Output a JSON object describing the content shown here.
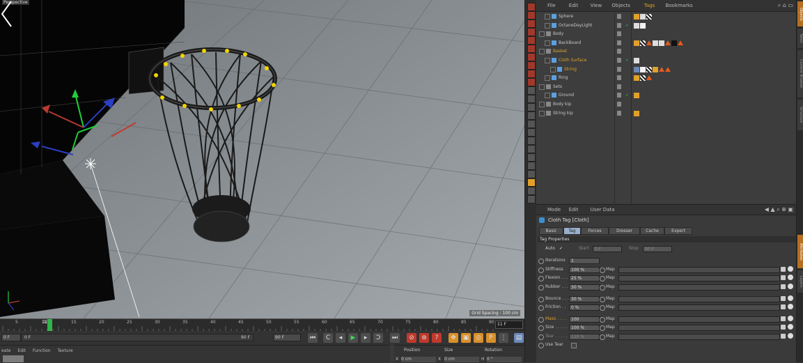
{
  "viewport": {
    "label": "Perspective",
    "grid_spacing": "Grid Spacing : 100 cm"
  },
  "timeline": {
    "ticks": [
      "5",
      "10",
      "15",
      "20",
      "25",
      "30",
      "35",
      "40",
      "45",
      "50",
      "55",
      "60",
      "65",
      "70",
      "75",
      "80",
      "85",
      "90"
    ],
    "current_frame_marker": "11",
    "frame_field": "11 F"
  },
  "transport": {
    "start_field": "0 F",
    "preview_start": "0 F",
    "preview_end": "90 F",
    "end_field": "90 F"
  },
  "material_manager": {
    "menu": [
      "eate",
      "Edit",
      "Function",
      "Texture"
    ]
  },
  "coordinates": {
    "headers": [
      "Position",
      "Size",
      "Rotation"
    ],
    "x_label": "X",
    "x_pos": "0 cm",
    "x_size_label": "X",
    "x_size": "0 cm",
    "h_label": "H",
    "h_rot": "0 °"
  },
  "object_manager": {
    "menu": [
      "File",
      "Edit",
      "View",
      "Objects",
      "Tags",
      "Bookmarks"
    ],
    "active_menu": "Tags",
    "objects": [
      {
        "name": "Sphere",
        "indent": 1,
        "highlight": false,
        "check": false
      },
      {
        "name": "OctaneDayLight",
        "indent": 1,
        "highlight": false,
        "check": true
      },
      {
        "name": "Body",
        "indent": 0,
        "highlight": false,
        "check": false
      },
      {
        "name": "BackBoard",
        "indent": 1,
        "highlight": false,
        "check": false
      },
      {
        "name": "Basket",
        "indent": 0,
        "highlight": true,
        "check": false
      },
      {
        "name": "Cloth Surface",
        "indent": 1,
        "highlight": true,
        "check": true
      },
      {
        "name": "String",
        "indent": 2,
        "highlight": true,
        "check": false
      },
      {
        "name": "Ring",
        "indent": 1,
        "highlight": false,
        "check": false
      },
      {
        "name": "Sets",
        "indent": 0,
        "highlight": false,
        "check": false
      },
      {
        "name": "Ground",
        "indent": 1,
        "highlight": false,
        "check": true
      },
      {
        "name": "Body kip",
        "indent": 0,
        "highlight": false,
        "check": false
      },
      {
        "name": "String kip",
        "indent": 0,
        "highlight": false,
        "check": false
      }
    ]
  },
  "attributes": {
    "menu": [
      "Mode",
      "Edit",
      "User Data"
    ],
    "title": "Cloth Tag [Cloth]",
    "tabs": [
      "Basic",
      "Tag",
      "Forces",
      "Dresser",
      "Cache",
      "Expert"
    ],
    "active_tab": "Tag",
    "section": "Tag Properties",
    "auto_label": "Auto",
    "auto_check": "✓",
    "start_label": "Start",
    "start_value": "0 F",
    "stop_label": "Stop",
    "stop_value": "90 F",
    "iterations_label": "Iterations",
    "iterations_value": "1",
    "map_label": "Map",
    "params": [
      {
        "label": "Stiffness",
        "value": "100 %"
      },
      {
        "label": "Flexion . . .",
        "value": "25 %"
      },
      {
        "label": "Rubber . . .",
        "value": "30 %"
      },
      {
        "label": "Bounce . . .",
        "value": "30 %"
      },
      {
        "label": "Friction . .",
        "value": "0 %"
      },
      {
        "label": "Mass . . . .",
        "value": "100"
      },
      {
        "label": "Size . . . . .",
        "value": "100 %"
      },
      {
        "label": "Tear . . . . .",
        "value": "120 %"
      }
    ],
    "use_tear_label": "Use Tear"
  },
  "right_tabs": [
    "Objects",
    "Takes",
    "Content Browser",
    "Structure",
    "Attributes",
    "Layers"
  ],
  "colors": {
    "accent_orange": "#e0a02a",
    "tag_triangle": "#e55a1c",
    "active_tab": "#98aecb"
  }
}
